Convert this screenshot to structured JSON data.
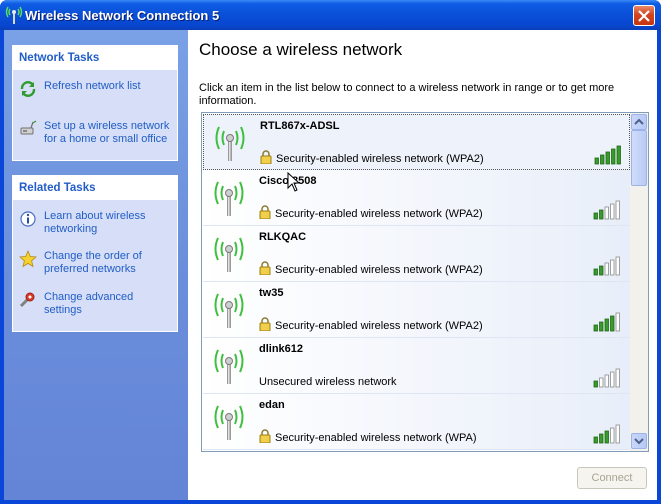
{
  "window": {
    "title": "Wireless Network Connection 5",
    "close_icon": "close-icon"
  },
  "sidebar": {
    "network_tasks": {
      "title": "Network Tasks",
      "items": [
        {
          "icon": "refresh-icon",
          "label": "Refresh network list"
        },
        {
          "icon": "setup-network-icon",
          "label": "Set up a wireless network for a home or small office"
        }
      ]
    },
    "related_tasks": {
      "title": "Related Tasks",
      "items": [
        {
          "icon": "info-icon",
          "label": "Learn about wireless networking"
        },
        {
          "icon": "star-icon",
          "label": "Change the order of preferred networks"
        },
        {
          "icon": "settings-icon",
          "label": "Change advanced settings"
        }
      ]
    }
  },
  "main": {
    "heading": "Choose a wireless network",
    "instruction": "Click an item in the list below to connect to a wireless network in range or to get more information.",
    "networks": [
      {
        "ssid": "RTL867x-ADSL",
        "security": "Security-enabled wireless network (WPA2)",
        "secured": true,
        "signal_bars": 5,
        "selected": true
      },
      {
        "ssid": "Cisco 8508",
        "security": "Security-enabled wireless network (WPA2)",
        "secured": true,
        "signal_bars": 2,
        "selected": false
      },
      {
        "ssid": "RLKQAC",
        "security": "Security-enabled wireless network (WPA2)",
        "secured": true,
        "signal_bars": 2,
        "selected": false
      },
      {
        "ssid": "tw35",
        "security": "Security-enabled wireless network (WPA2)",
        "secured": true,
        "signal_bars": 4,
        "selected": false
      },
      {
        "ssid": "dlink612",
        "security": "Unsecured wireless network",
        "secured": false,
        "signal_bars": 1,
        "selected": false
      },
      {
        "ssid": "edan",
        "security": "Security-enabled wireless network (WPA)",
        "secured": true,
        "signal_bars": 3,
        "selected": false
      }
    ],
    "connect_label": "Connect"
  },
  "colors": {
    "title_bar": "#0a4fd8",
    "link": "#215dc6",
    "signal_on": "#3a9a2c",
    "signal_off": "#ffffff"
  }
}
